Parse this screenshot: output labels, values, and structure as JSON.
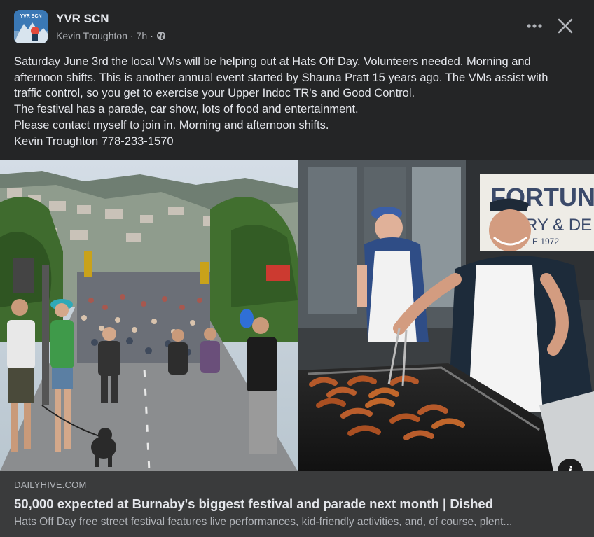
{
  "post": {
    "group_name": "YVR SCN",
    "author": "Kevin Troughton",
    "time": "7h",
    "separator": "·",
    "avatar_text": "YVR SCN",
    "lines": [
      "Saturday June 3rd the local VMs will be helping out at Hats Off Day. Volunteers needed. Morning and",
      "afternoon shifts. This is another annual event started by Shauna Pratt 15 years ago. The VMs assist with",
      "traffic control, so you get to exercise your Upper Indoc TR's and Good Control.",
      "The festival has a parade, car show, lots of food and entertainment.",
      "Please contact myself to join in. Morning and afternoon shifts.",
      "Kevin Troughton 778-233-1570"
    ]
  },
  "icons": {
    "more": "more-options-icon",
    "close": "close-icon",
    "audience": "globe-icon",
    "info": "info-icon"
  },
  "photo": {
    "sign_line1": "FORTUN",
    "sign_line2": "RY & DE",
    "sign_line3": "E 1972",
    "info_label": "i"
  },
  "link": {
    "domain": "DAILYHIVE.COM",
    "title": "50,000 expected at Burnaby's biggest festival and parade next month | Dished",
    "description": "Hats Off Day free street festival features live performances, kid-friendly activities, and, of course, plent..."
  },
  "colors": {
    "background": "#242526",
    "card": "#3a3b3c",
    "text_primary": "#e4e6eb",
    "text_secondary": "#b0b3b8"
  }
}
